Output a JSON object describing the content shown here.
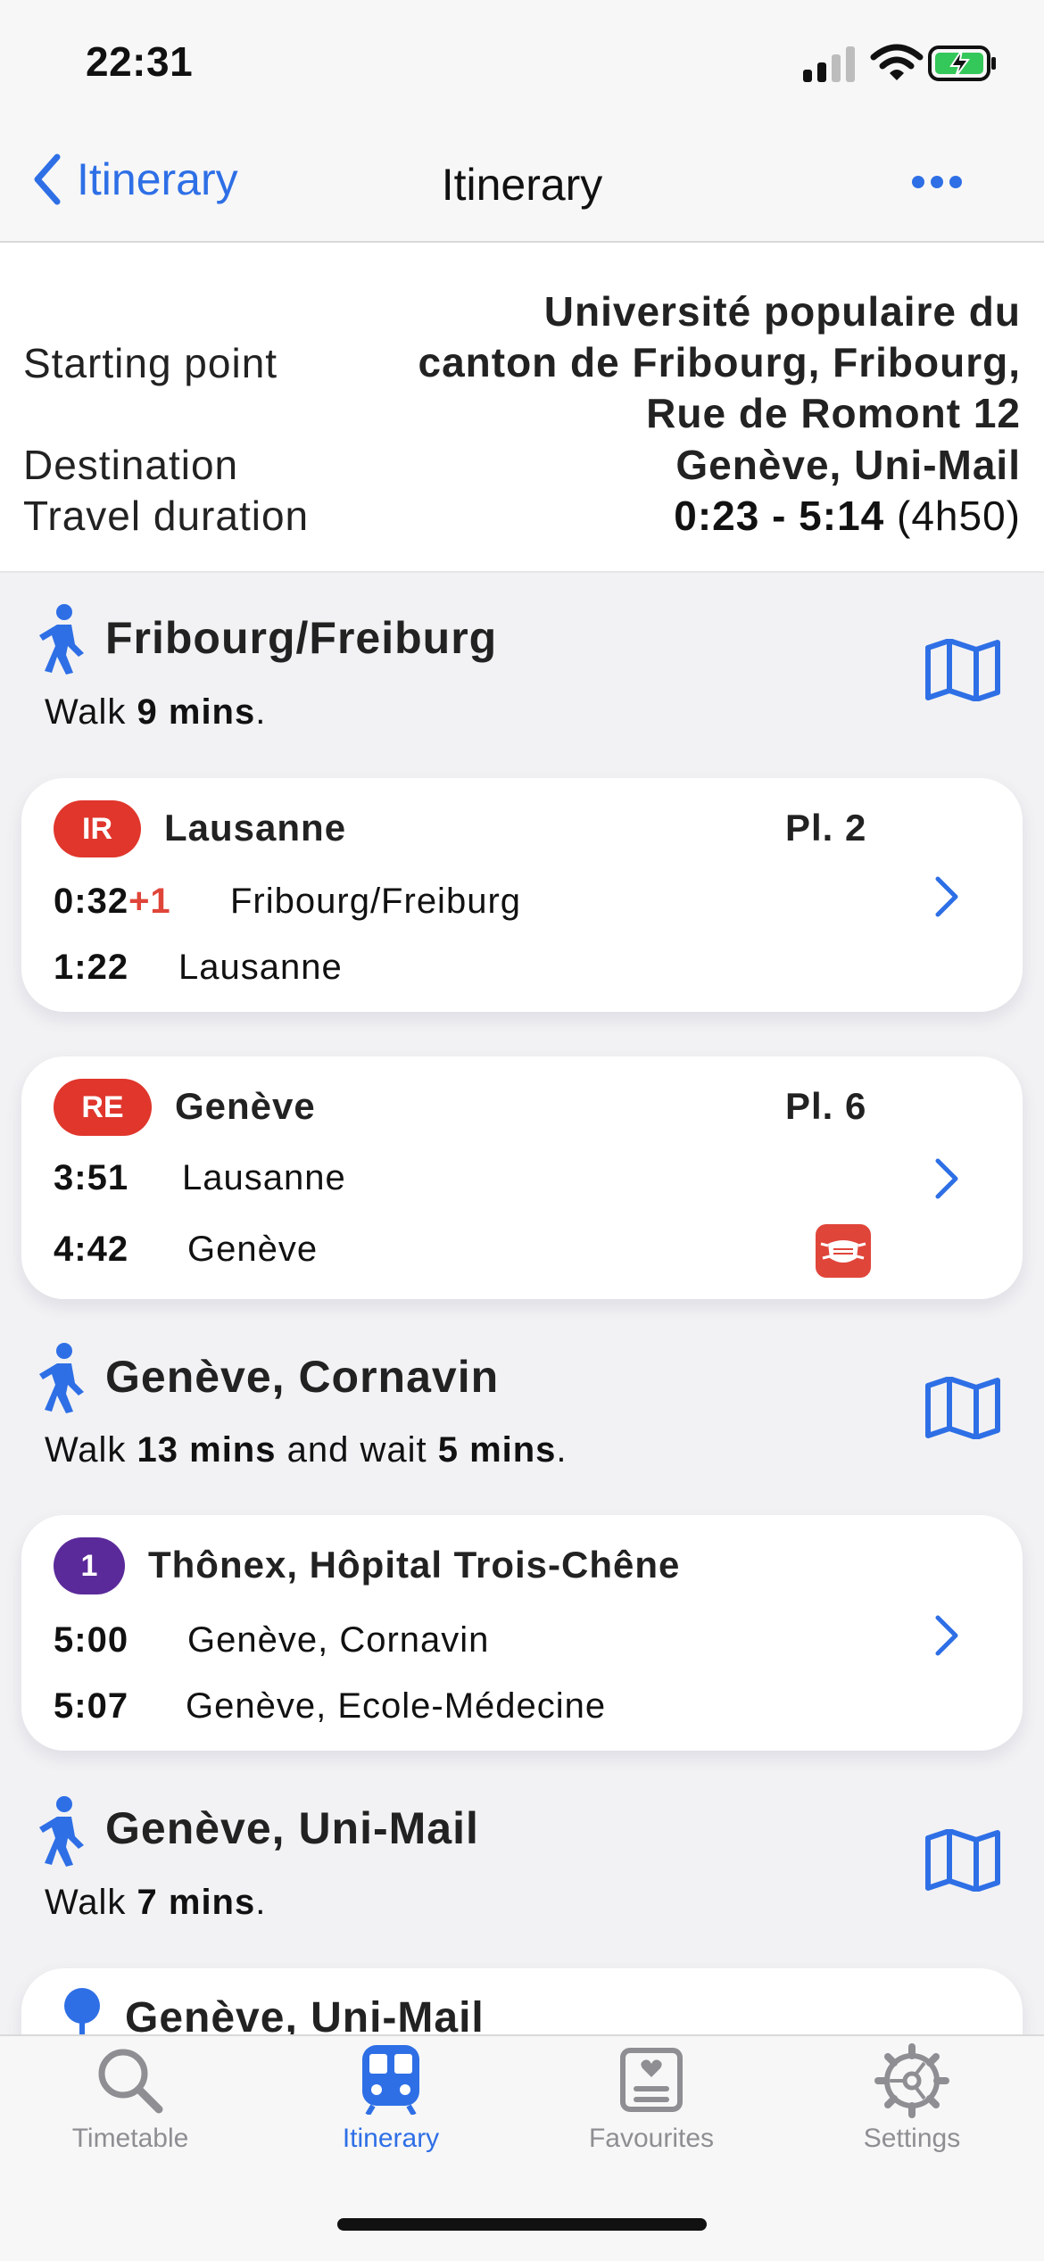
{
  "status": {
    "time": "22:31"
  },
  "nav": {
    "back_label": "Itinerary",
    "title": "Itinerary"
  },
  "summary": {
    "start_label": "Starting point",
    "start_value_line1": "Université populaire du",
    "start_value_line2": "canton de Fribourg, Fribourg,",
    "start_value_line3": "Rue de Romont 12",
    "destination_label": "Destination",
    "destination_value": "Genève, Uni-Mail",
    "duration_label": "Travel duration",
    "duration_value": "0:23 - 5:14",
    "duration_total": "(4h50)"
  },
  "legs": {
    "walk1": {
      "title": "Fribourg/Freiburg",
      "prefix": "Walk ",
      "mins": "9 mins",
      "suffix": "."
    },
    "train1": {
      "badge": "IR",
      "badge_color": "#e0362c",
      "destination": "Lausanne",
      "platform": "Pl. 2",
      "dep_time": "0:32",
      "dep_delay": "+1",
      "dep_station": "Fribourg/Freiburg",
      "arr_time": "1:22",
      "arr_station": "Lausanne"
    },
    "train2": {
      "badge": "RE",
      "badge_color": "#e0362c",
      "destination": "Genève",
      "platform": "Pl. 6",
      "dep_time": "3:51",
      "dep_station": "Lausanne",
      "arr_time": "4:42",
      "arr_station": "Genève"
    },
    "walk2": {
      "title": "Genève, Cornavin",
      "prefix": "Walk ",
      "mins": "13 mins",
      "middle": " and wait ",
      "wait": "5 mins",
      "suffix": "."
    },
    "tram1": {
      "badge": "1",
      "badge_color": "#5b2a9a",
      "destination": "Thônex, Hôpital Trois-Chêne",
      "dep_time": "5:00",
      "dep_station": "Genève, Cornavin",
      "arr_time": "5:07",
      "arr_station": "Genève, Ecole-Médecine"
    },
    "walk3": {
      "title": "Genève, Uni-Mail",
      "prefix": "Walk ",
      "mins": "7 mins",
      "suffix": "."
    },
    "final": {
      "title": "Genève, Uni-Mail"
    }
  },
  "tabs": [
    {
      "label": "Timetable",
      "icon": "search-icon"
    },
    {
      "label": "Itinerary",
      "icon": "train-icon",
      "active": true
    },
    {
      "label": "Favourites",
      "icon": "favourites-icon"
    },
    {
      "label": "Settings",
      "icon": "gear-icon"
    }
  ],
  "colors": {
    "accent": "#2e6fe6",
    "delay": "#e0453a",
    "tab_inactive": "#8e8e93"
  }
}
